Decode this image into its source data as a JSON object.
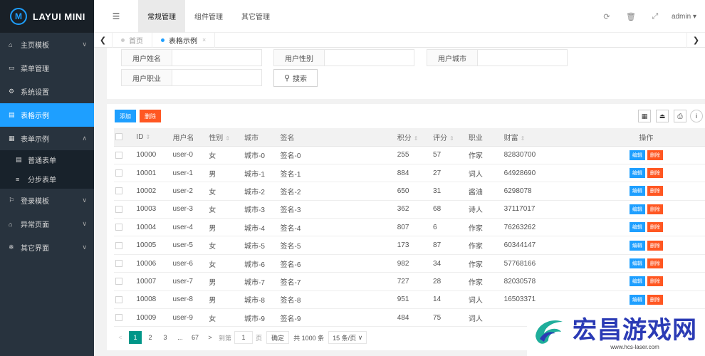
{
  "app": {
    "logo_letter": "M",
    "name": "LAYUI MINI"
  },
  "sidebar": {
    "items": [
      {
        "label": "主页模板",
        "icon": "home-icon",
        "glyph": "⌂",
        "arrow": "∨"
      },
      {
        "label": "菜单管理",
        "icon": "window-icon",
        "glyph": "▭",
        "arrow": ""
      },
      {
        "label": "系统设置",
        "icon": "gears-icon",
        "glyph": "⚙",
        "arrow": ""
      },
      {
        "label": "表格示例",
        "icon": "file-icon",
        "glyph": "▤",
        "arrow": "",
        "active": true
      },
      {
        "label": "表单示例",
        "icon": "calendar-icon",
        "glyph": "▦",
        "arrow": "∧"
      },
      {
        "label": "登录模板",
        "icon": "flag-icon",
        "glyph": "⚐",
        "arrow": "∨"
      },
      {
        "label": "异常页面",
        "icon": "home-icon",
        "glyph": "⌂",
        "arrow": "∨"
      },
      {
        "label": "其它界面",
        "icon": "snowflake-icon",
        "glyph": "❄",
        "arrow": "∨"
      }
    ],
    "submenu": [
      {
        "label": "普通表单",
        "icon": "list-alt-icon",
        "glyph": "▤"
      },
      {
        "label": "分步表单",
        "icon": "bars-icon",
        "glyph": "≡"
      }
    ]
  },
  "header": {
    "tabs": [
      "常规管理",
      "组件管理",
      "其它管理"
    ],
    "user": "admin"
  },
  "tabbar": {
    "tabs": [
      {
        "label": "首页"
      },
      {
        "label": "表格示例",
        "close": "×"
      }
    ]
  },
  "search": {
    "labels": [
      "用户姓名",
      "用户性别",
      "用户城市",
      "用户职业"
    ],
    "button": "搜索"
  },
  "toolbar": {
    "add": "添加",
    "delete": "删除"
  },
  "table": {
    "columns": [
      "ID",
      "用户名",
      "性别",
      "城市",
      "签名",
      "积分",
      "评分",
      "职业",
      "财富",
      "操作"
    ],
    "edit_label": "编辑",
    "delete_label": "删除",
    "rows": [
      [
        "10000",
        "user-0",
        "女",
        "城市-0",
        "签名-0",
        "255",
        "57",
        "作家",
        "82830700"
      ],
      [
        "10001",
        "user-1",
        "男",
        "城市-1",
        "签名-1",
        "884",
        "27",
        "词人",
        "64928690"
      ],
      [
        "10002",
        "user-2",
        "女",
        "城市-2",
        "签名-2",
        "650",
        "31",
        "酱油",
        "6298078"
      ],
      [
        "10003",
        "user-3",
        "女",
        "城市-3",
        "签名-3",
        "362",
        "68",
        "诗人",
        "37117017"
      ],
      [
        "10004",
        "user-4",
        "男",
        "城市-4",
        "签名-4",
        "807",
        "6",
        "作家",
        "76263262"
      ],
      [
        "10005",
        "user-5",
        "女",
        "城市-5",
        "签名-5",
        "173",
        "87",
        "作家",
        "60344147"
      ],
      [
        "10006",
        "user-6",
        "女",
        "城市-6",
        "签名-6",
        "982",
        "34",
        "作家",
        "57768166"
      ],
      [
        "10007",
        "user-7",
        "男",
        "城市-7",
        "签名-7",
        "727",
        "28",
        "作家",
        "82030578"
      ],
      [
        "10008",
        "user-8",
        "男",
        "城市-8",
        "签名-8",
        "951",
        "14",
        "词人",
        "16503371"
      ],
      [
        "10009",
        "user-9",
        "女",
        "城市-9",
        "签名-9",
        "484",
        "75",
        "词人",
        ""
      ]
    ]
  },
  "pager": {
    "prev": "<",
    "pages": [
      "1",
      "2",
      "3"
    ],
    "ellipsis": "...",
    "last": "67",
    "next": ">",
    "goto": "到第",
    "current": "1",
    "page_unit": "页",
    "confirm": "确定",
    "total": "共 1000 条",
    "page_size": "15 条/页"
  },
  "watermark": {
    "text": "宏昌游戏网",
    "url": "www.hcs-laser.com"
  },
  "colors": {
    "sidebar": "#28333e",
    "accent": "#1e9fff",
    "danger": "#ff5722",
    "pager_current": "#009688"
  }
}
